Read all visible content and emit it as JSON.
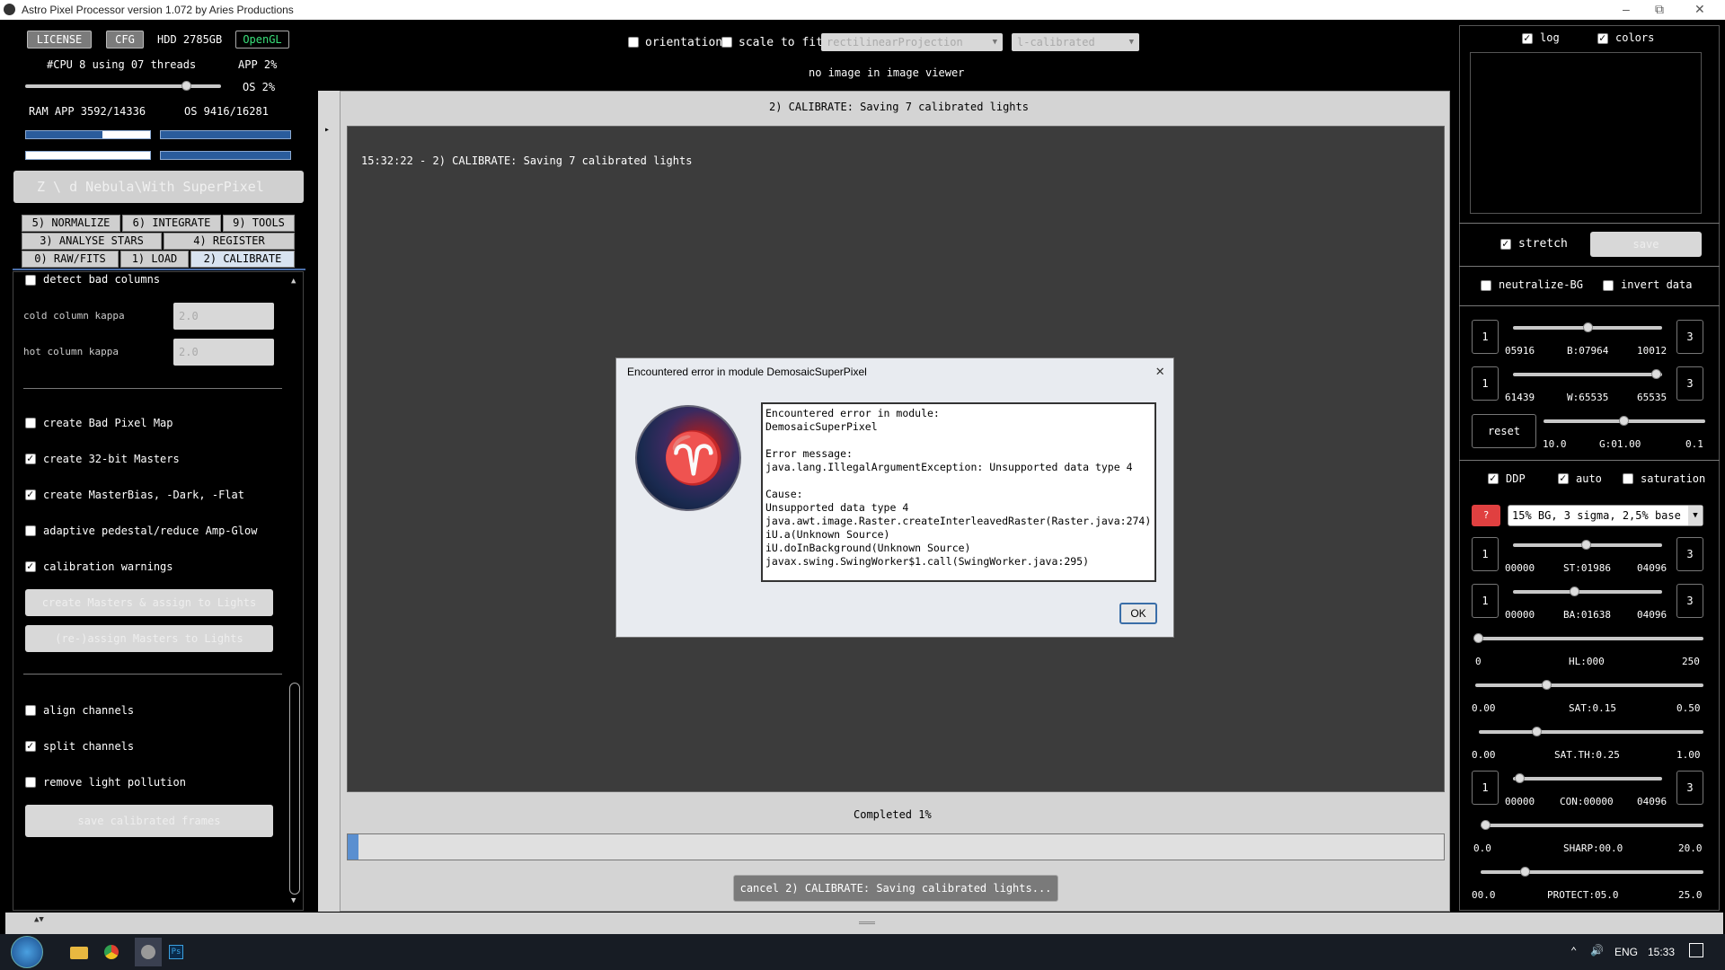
{
  "window": {
    "title": "Astro Pixel Processor version 1.072 by Aries Productions"
  },
  "top": {
    "license": "LICENSE",
    "cfg": "CFG",
    "hdd": "HDD 2785GB",
    "opengl": "OpenGL",
    "cpu": "#CPU 8   using 07 threads",
    "app_pct": "APP 2%",
    "os_pct": "OS 2%",
    "ram": "RAM  APP 3592/14336",
    "os_mem": "OS 9416/16281",
    "path": "Z \\   d Nebula\\With SuperPixel"
  },
  "tabs": {
    "row1": [
      "5) NORMALIZE",
      "6) INTEGRATE",
      "9) TOOLS"
    ],
    "row2": [
      "3) ANALYSE STARS",
      "4) REGISTER"
    ],
    "row3": [
      "0) RAW/FITS",
      "1) LOAD",
      "2) CALIBRATE"
    ]
  },
  "left": {
    "detect_bad_columns": "detect bad columns",
    "cold_label": "cold column kappa",
    "cold_val": "2.0",
    "hot_label": "hot column kappa",
    "hot_val": "2.0",
    "opt1": "create Bad Pixel Map",
    "opt2": "create 32-bit Masters",
    "opt3": "create MasterBias, -Dark, -Flat",
    "opt4": "adaptive pedestal/reduce Amp-Glow",
    "opt5": "calibration warnings",
    "btn1": "create Masters & assign to Lights",
    "btn2": "(re-)assign Masters to Lights",
    "opt6": "align channels",
    "opt7": "split channels",
    "opt8": "remove light pollution",
    "btn3": "save calibrated frames"
  },
  "toolbar": {
    "orientation": "orientation",
    "scale": "scale to fit",
    "projection": "rectilinearProjection",
    "mode": "l-calibrated",
    "noimage": "no image in image viewer"
  },
  "center": {
    "header": "2) CALIBRATE: Saving 7 calibrated lights",
    "log": "15:32:22 - 2) CALIBRATE: Saving 7 calibrated lights",
    "completed": "Completed 1%",
    "progress": 0.01,
    "cancel": "cancel 2) CALIBRATE: Saving calibrated lights..."
  },
  "dialog": {
    "title": "Encountered error in module DemosaicSuperPixel",
    "message": "Encountered error in module:\nDemosaicSuperPixel\n\nError message:\njava.lang.IllegalArgumentException: Unsupported data type 4\n\nCause:\nUnsupported data type 4\njava.awt.image.Raster.createInterleavedRaster(Raster.java:274)\niU.a(Unknown Source)\niU.doInBackground(Unknown Source)\njavax.swing.SwingWorker$1.call(SwingWorker.java:295)",
    "ok": "OK"
  },
  "right": {
    "log": "log",
    "colors": "colors",
    "stretch": "stretch",
    "save": "save",
    "neutralize": "neutralize-BG",
    "invert": "invert data",
    "b_min": "05916",
    "b_lbl": "B:07964",
    "b_max": "10012",
    "w_min": "61439",
    "w_lbl": "W:65535",
    "w_max": "65535",
    "reset": "reset",
    "g_min": "10.0",
    "g_lbl": "G:01.00",
    "g_max": "0.1",
    "ddp": "DDP",
    "auto": "auto",
    "saturation": "saturation",
    "preset": "15% BG, 3 sigma, 2,5% base",
    "q": "?",
    "st_min": "00000",
    "st_lbl": "ST:01986",
    "st_max": "04096",
    "ba_min": "00000",
    "ba_lbl": "BA:01638",
    "ba_max": "04096",
    "hl_min": "0",
    "hl_lbl": "HL:000",
    "hl_max": "250",
    "sat_min": "0.00",
    "sat_lbl": "SAT:0.15",
    "sat_max": "0.50",
    "satth_min": "0.00",
    "satth_lbl": "SAT.TH:0.25",
    "satth_max": "1.00",
    "con_min": "00000",
    "con_lbl": "CON:00000",
    "con_max": "04096",
    "sharp_min": "0.0",
    "sharp_lbl": "SHARP:00.0",
    "sharp_max": "20.0",
    "prot_min": "00.0",
    "prot_lbl": "PROTECT:05.0",
    "prot_max": "25.0",
    "one": "1",
    "three": "3"
  },
  "taskbar": {
    "lang": "ENG",
    "time": "15:33"
  }
}
